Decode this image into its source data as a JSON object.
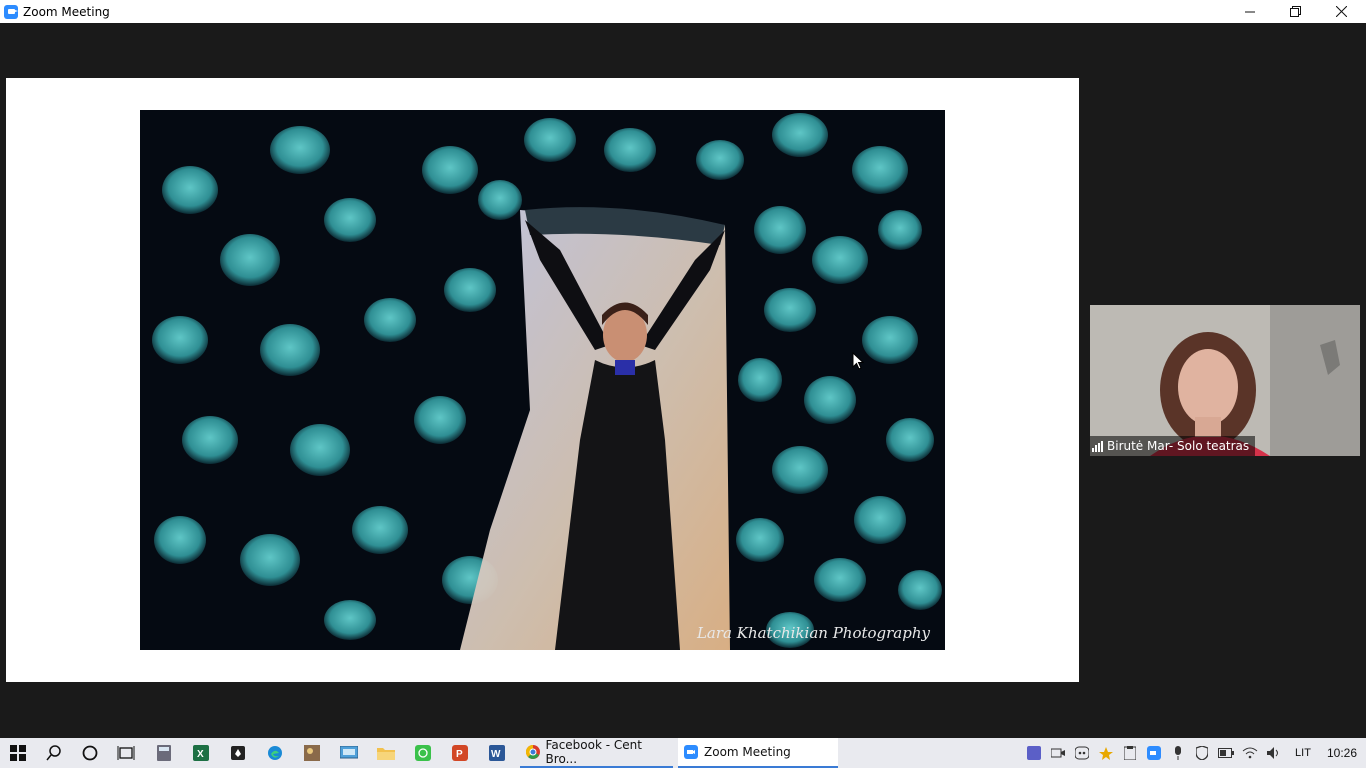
{
  "window": {
    "title": "Zoom Meeting"
  },
  "content": {
    "photo_credit": "Lara Khatchikian Photography"
  },
  "participant": {
    "name": "Birutė Mar- Solo teatras"
  },
  "taskbar": {
    "apps": [
      {
        "label": "Facebook - Cent Bro..."
      },
      {
        "label": "Zoom Meeting"
      }
    ],
    "tray": {
      "language": "LIT",
      "time": "10:26"
    }
  },
  "colors": {
    "zoom_blue": "#2d8cff",
    "background": "#1a1a1a",
    "taskbar": "#e9eaef"
  }
}
